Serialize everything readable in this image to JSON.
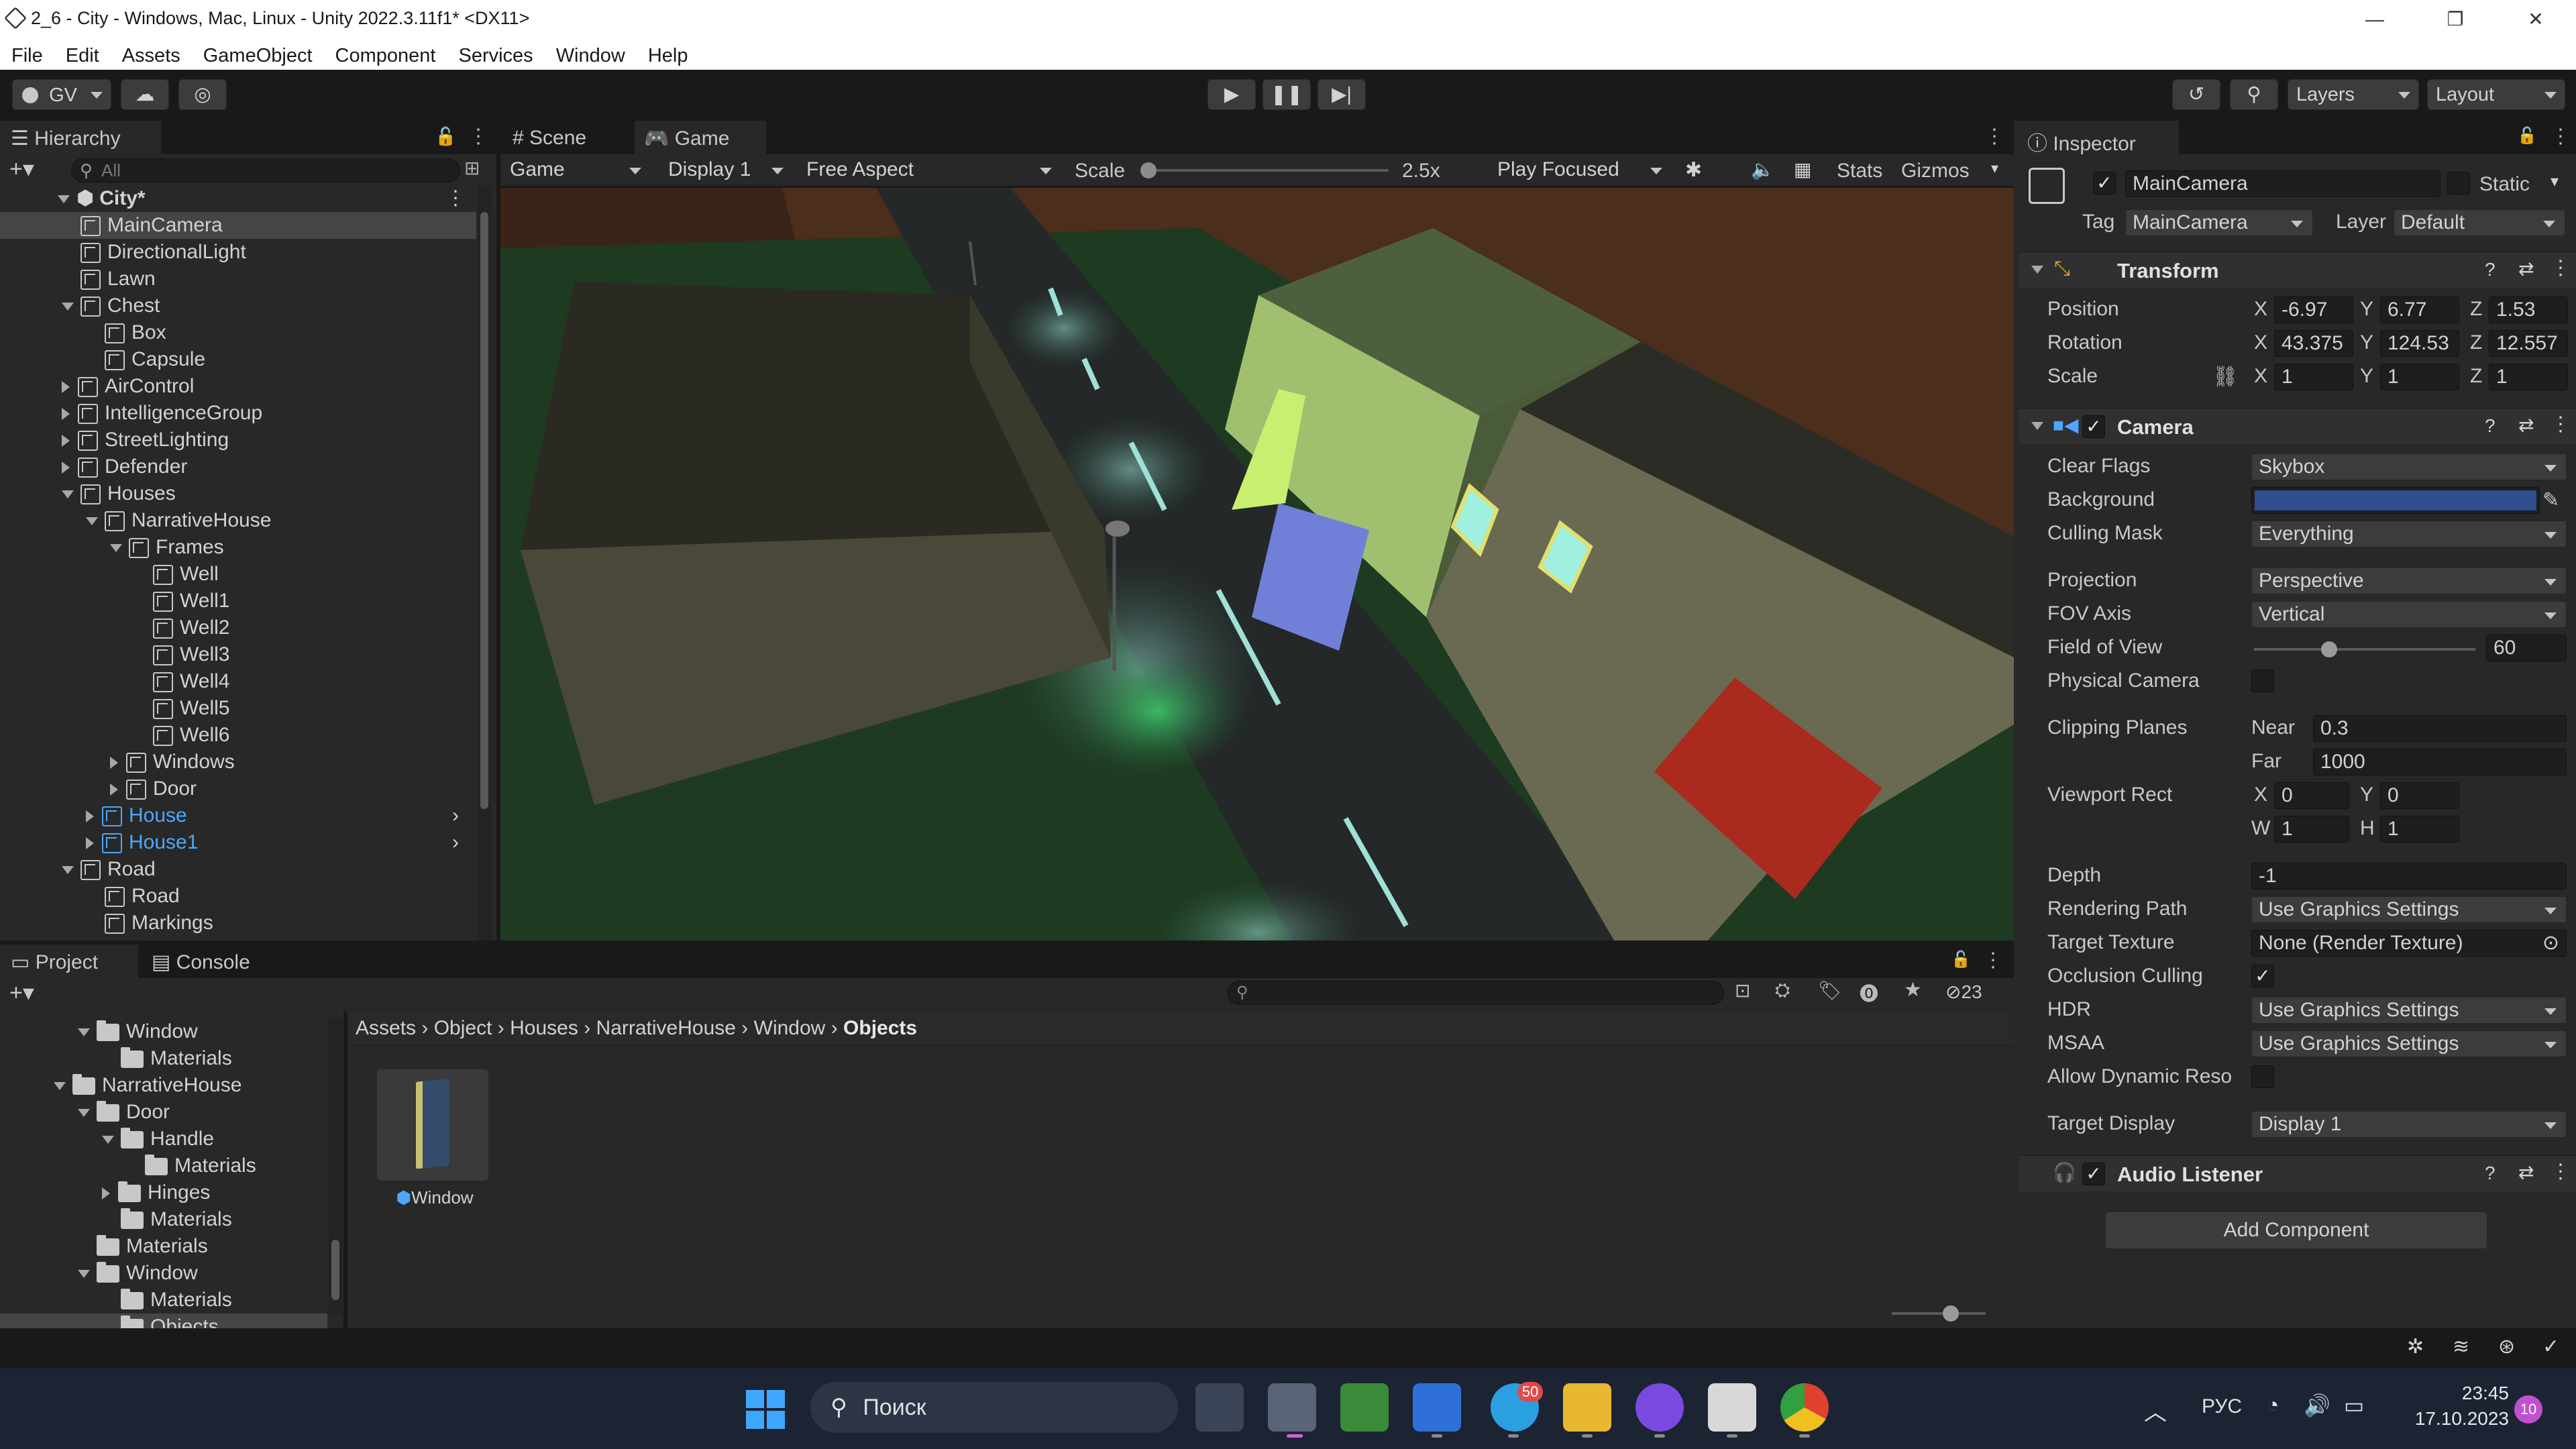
{
  "window": {
    "title": "2_6 - City - Windows, Mac, Linux - Unity 2022.3.11f1* <DX11>",
    "minimize_icon": "minimize-icon",
    "maximize_icon": "restore-icon",
    "close_icon": "close-icon"
  },
  "menu": [
    "File",
    "Edit",
    "Assets",
    "GameObject",
    "Component",
    "Services",
    "Window",
    "Help"
  ],
  "toolbar": {
    "account": "GV",
    "layers": "Layers",
    "layout": "Layout"
  },
  "hierarchy": {
    "tab": "Hierarchy",
    "search_placeholder": "All",
    "scene": "City*",
    "items": [
      {
        "label": "MainCamera",
        "level": 1,
        "fold": "none",
        "blue": false,
        "selected": true
      },
      {
        "label": "DirectionalLight",
        "level": 1,
        "fold": "none",
        "blue": false
      },
      {
        "label": "Lawn",
        "level": 1,
        "fold": "none",
        "blue": false
      },
      {
        "label": "Chest",
        "level": 1,
        "fold": "open",
        "blue": false
      },
      {
        "label": "Box",
        "level": 2,
        "fold": "none",
        "blue": false
      },
      {
        "label": "Capsule",
        "level": 2,
        "fold": "none",
        "blue": false
      },
      {
        "label": "AirControl",
        "level": 1,
        "fold": "closed",
        "blue": false
      },
      {
        "label": "IntelligenceGroup",
        "level": 1,
        "fold": "closed",
        "blue": false
      },
      {
        "label": "StreetLighting",
        "level": 1,
        "fold": "closed",
        "blue": false
      },
      {
        "label": "Defender",
        "level": 1,
        "fold": "closed",
        "blue": false
      },
      {
        "label": "Houses",
        "level": 1,
        "fold": "open",
        "blue": false
      },
      {
        "label": "NarrativeHouse",
        "level": 2,
        "fold": "open",
        "blue": false
      },
      {
        "label": "Frames",
        "level": 3,
        "fold": "open",
        "blue": false
      },
      {
        "label": "Well",
        "level": 4,
        "fold": "none",
        "blue": false
      },
      {
        "label": "Well1",
        "level": 4,
        "fold": "none",
        "blue": false
      },
      {
        "label": "Well2",
        "level": 4,
        "fold": "none",
        "blue": false
      },
      {
        "label": "Well3",
        "level": 4,
        "fold": "none",
        "blue": false
      },
      {
        "label": "Well4",
        "level": 4,
        "fold": "none",
        "blue": false
      },
      {
        "label": "Well5",
        "level": 4,
        "fold": "none",
        "blue": false
      },
      {
        "label": "Well6",
        "level": 4,
        "fold": "none",
        "blue": false
      },
      {
        "label": "Windows",
        "level": 3,
        "fold": "closed",
        "blue": false
      },
      {
        "label": "Door",
        "level": 3,
        "fold": "closed",
        "blue": false
      },
      {
        "label": "House",
        "level": 2,
        "fold": "closed",
        "blue": true
      },
      {
        "label": "House1",
        "level": 2,
        "fold": "closed",
        "blue": true
      },
      {
        "label": "Road",
        "level": 1,
        "fold": "open",
        "blue": false
      },
      {
        "label": "Road",
        "level": 2,
        "fold": "none",
        "blue": false
      },
      {
        "label": "Markings",
        "level": 2,
        "fold": "none",
        "blue": false
      }
    ]
  },
  "game_view": {
    "tabs": [
      "Scene",
      "Game"
    ],
    "display_mode": "Game",
    "display": "Display 1",
    "aspect": "Free Aspect",
    "scale_label": "Scale",
    "scale_value": "2.5x",
    "play_mode": "Play Focused",
    "stats": "Stats",
    "gizmos": "Gizmos"
  },
  "inspector": {
    "tab": "Inspector",
    "object_name": "MainCamera",
    "static_label": "Static",
    "tag_label": "Tag",
    "tag_value": "MainCamera",
    "layer_label": "Layer",
    "layer_value": "Default",
    "transform": {
      "title": "Transform",
      "position_label": "Position",
      "position": {
        "x": "-6.97",
        "y": "6.77",
        "z": "1.53"
      },
      "rotation_label": "Rotation",
      "rotation": {
        "x": "43.375",
        "y": "124.53",
        "z": "12.557"
      },
      "scale_label": "Scale",
      "scale": {
        "x": "1",
        "y": "1",
        "z": "1"
      }
    },
    "camera": {
      "title": "Camera",
      "clear_flags_label": "Clear Flags",
      "clear_flags": "Skybox",
      "background_label": "Background",
      "background_color": "#2f4f8f",
      "culling_mask_label": "Culling Mask",
      "culling_mask": "Everything",
      "projection_label": "Projection",
      "projection": "Perspective",
      "fov_axis_label": "FOV Axis",
      "fov_axis": "Vertical",
      "fov_label": "Field of View",
      "fov": "60",
      "physical_label": "Physical Camera",
      "clipping_label": "Clipping Planes",
      "near_label": "Near",
      "near": "0.3",
      "far_label": "Far",
      "far": "1000",
      "viewport_label": "Viewport Rect",
      "vx": "0",
      "vy": "0",
      "vw": "1",
      "vh": "1",
      "depth_label": "Depth",
      "depth": "-1",
      "rendering_path_label": "Rendering Path",
      "rendering_path": "Use Graphics Settings",
      "target_texture_label": "Target Texture",
      "target_texture": "None (Render Texture)",
      "occlusion_label": "Occlusion Culling",
      "hdr_label": "HDR",
      "hdr": "Use Graphics Settings",
      "msaa_label": "MSAA",
      "msaa": "Use Graphics Settings",
      "dynamic_label": "Allow Dynamic Reso",
      "target_display_label": "Target Display",
      "target_display": "Display 1"
    },
    "audio_listener": "Audio Listener",
    "add_component": "Add Component"
  },
  "project": {
    "tabs": [
      "Project",
      "Console"
    ],
    "hidden_count": "23",
    "breadcrumb": [
      "Assets",
      "Object",
      "Houses",
      "NarrativeHouse",
      "Window",
      "Objects"
    ],
    "tree": [
      {
        "label": "Window",
        "level": 1,
        "fold": "open"
      },
      {
        "label": "Materials",
        "level": 2,
        "fold": "none"
      },
      {
        "label": "NarrativeHouse",
        "level": 0,
        "fold": "open"
      },
      {
        "label": "Door",
        "level": 1,
        "fold": "open"
      },
      {
        "label": "Handle",
        "level": 2,
        "fold": "open"
      },
      {
        "label": "Materials",
        "level": 3,
        "fold": "none"
      },
      {
        "label": "Hinges",
        "level": 2,
        "fold": "closed"
      },
      {
        "label": "Materials",
        "level": 2,
        "fold": "none"
      },
      {
        "label": "Materials",
        "level": 1,
        "fold": "none"
      },
      {
        "label": "Window",
        "level": 1,
        "fold": "open"
      },
      {
        "label": "Materials",
        "level": 2,
        "fold": "none"
      },
      {
        "label": "Objects",
        "level": 2,
        "fold": "none",
        "selected": true
      }
    ],
    "asset": "Window"
  },
  "taskbar": {
    "search": "Поиск",
    "language": "РУС",
    "time": "23:45",
    "date": "17.10.2023",
    "telegram_badge": "50",
    "notification_count": "10"
  }
}
